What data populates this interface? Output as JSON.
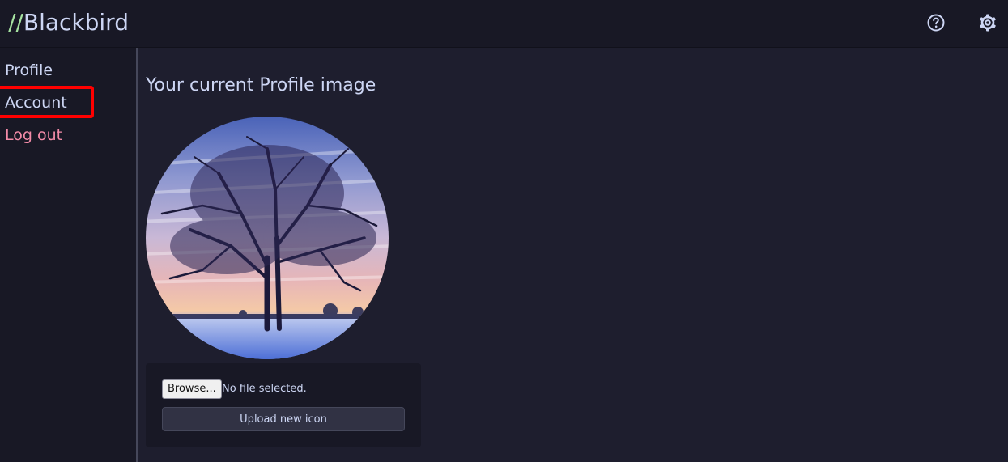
{
  "header": {
    "logo_slashes": "//",
    "logo_text": "Blackbird",
    "icons": [
      "help-circle-icon",
      "gear-icon"
    ]
  },
  "sidebar": {
    "items": [
      {
        "label": "Profile"
      },
      {
        "label": "Account"
      },
      {
        "label": "Log out"
      }
    ]
  },
  "main": {
    "title": "Your current Profile image",
    "upload": {
      "browse_label": "Browse...",
      "file_status": "No file selected.",
      "upload_label": "Upload new icon"
    }
  },
  "colors": {
    "background": "#1e1e2e",
    "panel": "#181825",
    "text": "#cdd6f4",
    "logout": "#f38ba8",
    "logo_accent": "#a6e3a1",
    "highlight": "#ff0000"
  }
}
